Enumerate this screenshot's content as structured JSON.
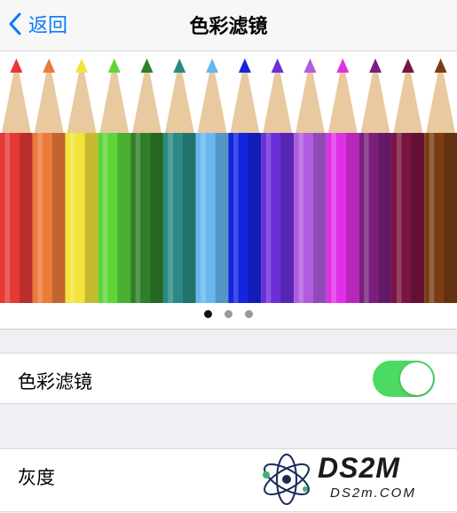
{
  "nav": {
    "back_label": "返回",
    "title": "色彩滤镜"
  },
  "carousel": {
    "pencil_colors": [
      "#e53935",
      "#ec7a3a",
      "#f2e43a",
      "#5ed63a",
      "#2f7f2a",
      "#2b8a86",
      "#68b8ef",
      "#1424e0",
      "#6a2fd8",
      "#b05be0",
      "#e030e6",
      "#7a1f7e",
      "#7a1441",
      "#7a3d14"
    ],
    "pages": 3,
    "active_page": 0
  },
  "settings": {
    "color_filter_label": "色彩滤镜",
    "color_filter_enabled": true,
    "grayscale_label": "灰度"
  },
  "watermark": {
    "logo_text": "DS2M",
    "url_text": "DS2m.COM"
  }
}
